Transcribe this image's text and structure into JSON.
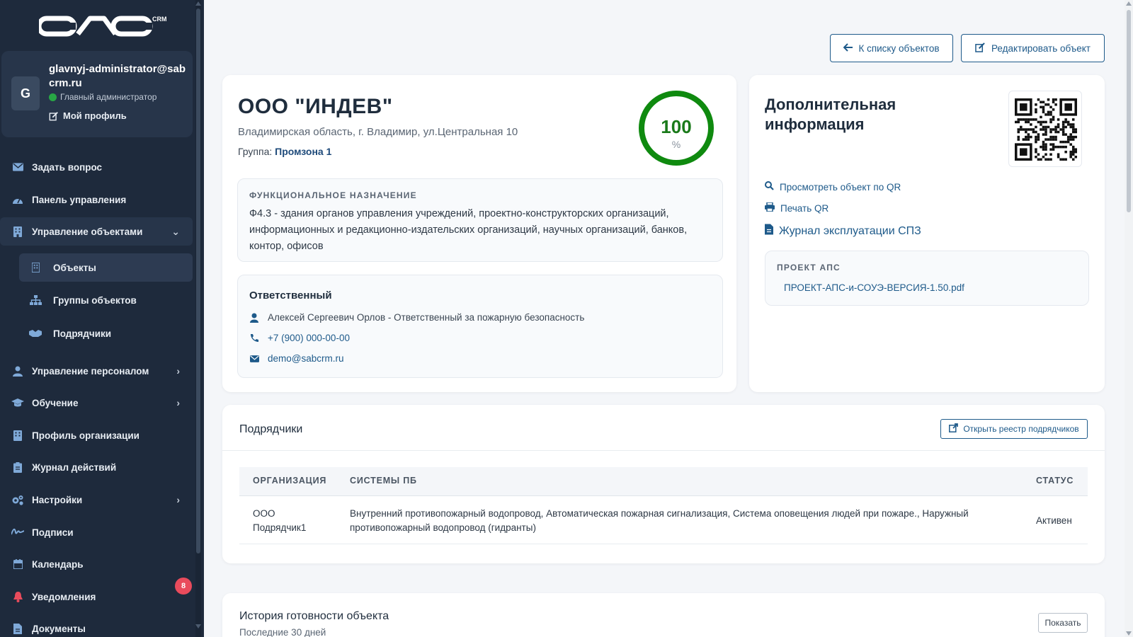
{
  "logo": {
    "text": "CRM"
  },
  "user": {
    "avatar_letter": "G",
    "name": "glavnyj-administrator@sabcrm.ru",
    "role": "Главный администратор",
    "profile_link": "Мой профиль"
  },
  "nav": {
    "ask": "Задать вопрос",
    "dashboard": "Панель управления",
    "objects_mgmt": "Управление объектами",
    "objects": "Объекты",
    "object_groups": "Группы объектов",
    "contractors": "Подрядчики",
    "staff": "Управление персоналом",
    "training": "Обучение",
    "org_profile": "Профиль организации",
    "journal": "Журнал действий",
    "settings": "Настройки",
    "signatures": "Подписи",
    "calendar": "Календарь",
    "notifications": "Уведомления",
    "notifications_count": "8",
    "documents": "Документы"
  },
  "top_buttons": {
    "back": "К списку объектов",
    "edit": "Редактировать объект"
  },
  "object": {
    "title": "ООО \"ИНДЕВ\"",
    "address": "Владимирская область, г. Владимир, ул.Центральная 10",
    "group_label": "Группа:",
    "group_value": "Промзона 1",
    "readiness": 100,
    "readiness_text": "100",
    "readiness_unit": "%",
    "func_label": "Функциональное назначение",
    "func_text": "Ф4.3 - здания органов управления учреждений, проектно-конструкторских организаций, информационных и редакционно-издательских организаций, научных организаций, банков, контор, офисов",
    "responsible_title": "Ответственный",
    "responsible_person": "Алексей Сергеевич Орлов - Ответственный за пожарную безопасность",
    "phone": "+7 (900) 000-00-00",
    "email": "demo@sabcrm.ru"
  },
  "info": {
    "title": "Дополнительная информация",
    "view_qr": "Просмотреть объект по QR",
    "print_qr": "Печать QR",
    "journal": "Журнал эксплуатации СПЗ",
    "project_label": "Проект АПС",
    "project_file": "ПРОЕКТ-АПС-и-СОУЭ-ВЕРСИЯ-1.50.pdf"
  },
  "contractors": {
    "title": "Подрядчики",
    "open_registry": "Открыть реестр подрядчиков",
    "columns": [
      "ОРГАНИЗАЦИЯ",
      "СИСТЕМЫ ПБ",
      "СТАТУС"
    ],
    "rows": [
      {
        "org": "ООО Подрядчик1",
        "systems": "Внутренний противопожарный водопровод, Автоматическая пожарная сигнализация, Система оповещения людей при пожаре., Наружный противопожарный водопровод (гидранты)",
        "status": "Активен"
      }
    ]
  },
  "history": {
    "title": "История готовности объекта",
    "subtitle": "Последние 30 дней",
    "show": "Показать"
  },
  "colors": {
    "sidebar": "#1e2a3c",
    "accent": "#1e5a8a",
    "progress": "#0f8a0f",
    "badge": "#e94b5c"
  }
}
